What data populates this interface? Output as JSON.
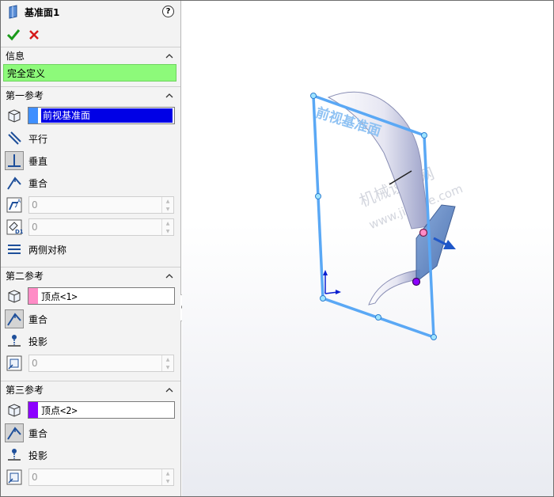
{
  "panel": {
    "title": "基准面1",
    "help_icon": "question-icon",
    "help_label": "?",
    "ok_icon": "checkmark-icon",
    "cancel_icon": "x-icon",
    "info": {
      "header": "信息",
      "status": "完全定义"
    },
    "ref1": {
      "header": "第一参考",
      "selection": "前视基准面",
      "swatch_color": "#3f8fff",
      "options": [
        {
          "label": "平行",
          "icon": "parallel-icon"
        },
        {
          "label": "垂直",
          "icon": "perpendicular-icon"
        },
        {
          "label": "重合",
          "icon": "coincident-icon"
        }
      ],
      "angle_value": "0",
      "offset_value": "0",
      "symmetric_label": "两侧对称"
    },
    "ref2": {
      "header": "第二参考",
      "selection": "顶点<1>",
      "swatch_color": "#ff8cc6",
      "options": [
        {
          "label": "重合",
          "icon": "coincident-icon"
        },
        {
          "label": "投影",
          "icon": "project-icon"
        }
      ],
      "value": "0"
    },
    "ref3": {
      "header": "第三参考",
      "selection": "顶点<2>",
      "swatch_color": "#8c00ff",
      "options": [
        {
          "label": "重合",
          "icon": "coincident-icon"
        },
        {
          "label": "投影",
          "icon": "project-icon"
        }
      ],
      "value": "0"
    }
  },
  "viewport": {
    "plane_label": "前视基准面",
    "watermark_line1": "机械设计网",
    "watermark_line2": "www.jixiege.com",
    "plane_color": "#5aa8f5"
  }
}
